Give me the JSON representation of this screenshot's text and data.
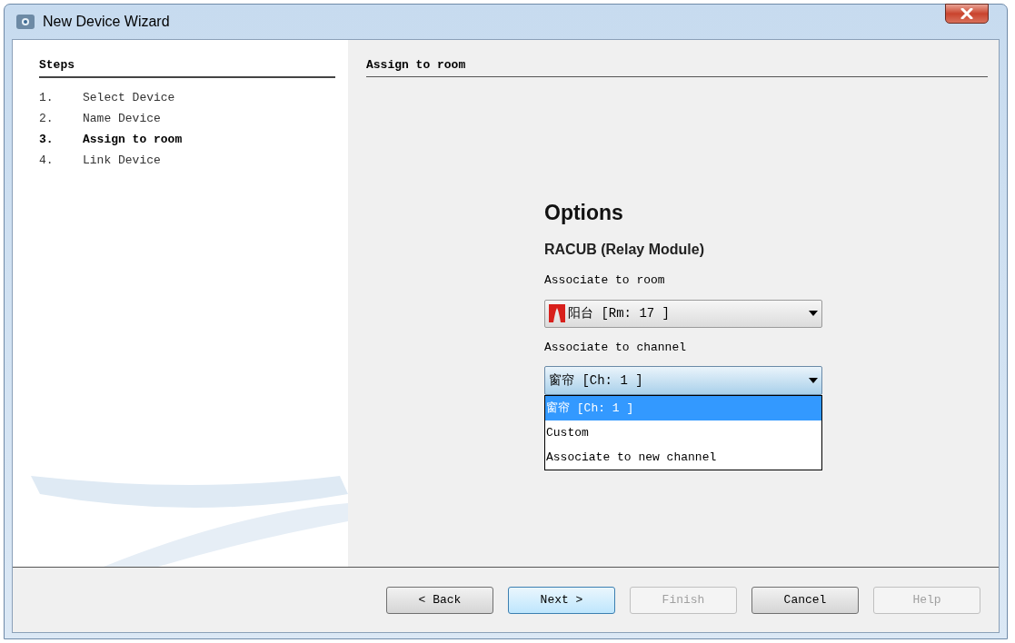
{
  "window": {
    "title": "New Device Wizard"
  },
  "steps": {
    "title": "Steps",
    "items": [
      {
        "number": "1.",
        "label": "Select Device",
        "selected": false
      },
      {
        "number": "2.",
        "label": "Name Device",
        "selected": false
      },
      {
        "number": "3.",
        "label": "Assign to room",
        "selected": true
      },
      {
        "number": "4.",
        "label": "Link Device",
        "selected": false
      }
    ]
  },
  "panel": {
    "title": "Assign to room",
    "heading": "Options",
    "device": "RACUB (Relay Module)",
    "room_label": "Associate to room",
    "room_value": "阳台 [Rm: 17 ]",
    "channel_label": "Associate to channel",
    "channel_value": "窗帘 [Ch: 1 ]",
    "channel_options": [
      {
        "label": "窗帘 [Ch: 1 ]",
        "selected": true
      },
      {
        "label": "Custom",
        "selected": false
      },
      {
        "label": "Associate to new channel",
        "selected": false
      }
    ]
  },
  "buttons": [
    {
      "label": "< Back",
      "disabled": false,
      "focused": false
    },
    {
      "label": "Next >",
      "disabled": false,
      "focused": true
    },
    {
      "label": "Finish",
      "disabled": true,
      "focused": false
    },
    {
      "label": "Cancel",
      "disabled": false,
      "focused": false
    },
    {
      "label": "Help",
      "disabled": true,
      "focused": false
    }
  ]
}
